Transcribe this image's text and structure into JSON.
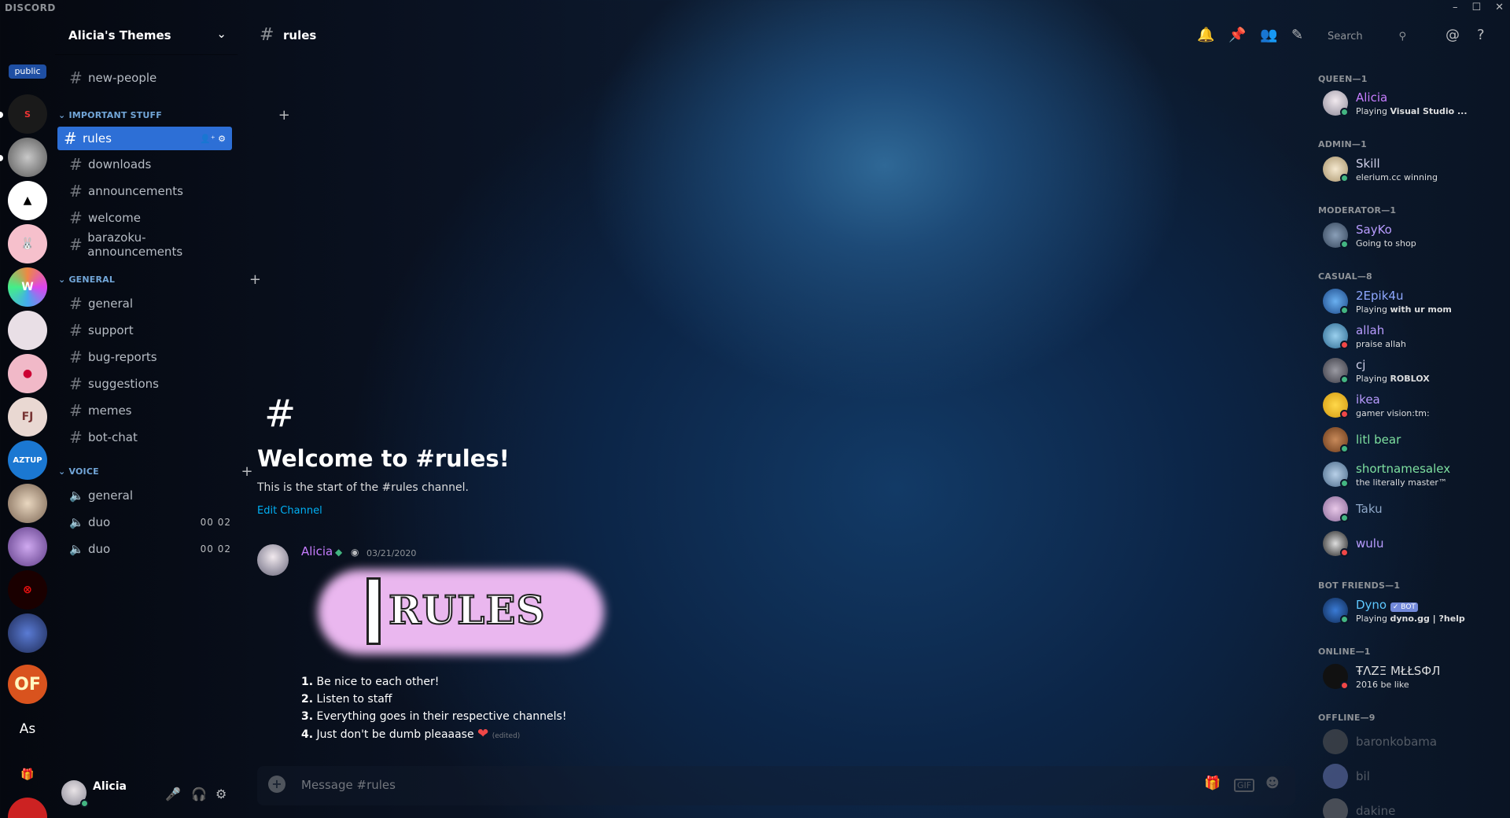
{
  "app": {
    "brand": "DISCORD"
  },
  "window": {
    "controls": [
      "–",
      "☐",
      "✕"
    ]
  },
  "server_list": {
    "public_badge": "public",
    "as_label": "As",
    "of_label": "OF"
  },
  "guild": {
    "name": "Alicia's Themes"
  },
  "channels": {
    "top": [
      {
        "name": "new-people"
      }
    ],
    "categories": [
      {
        "name": "IMPORTANT STUFF",
        "channels": [
          "rules",
          "downloads",
          "announcements",
          "welcome",
          "barazoku-announcements"
        ]
      },
      {
        "name": "GENERAL",
        "channels": [
          "general",
          "support",
          "bug-reports",
          "suggestions",
          "memes",
          "bot-chat"
        ]
      },
      {
        "name": "VOICE",
        "voice": [
          {
            "name": "general"
          },
          {
            "name": "duo",
            "count": "00 02"
          },
          {
            "name": "duo",
            "count": "00 02"
          }
        ]
      }
    ],
    "active": "rules"
  },
  "user": {
    "name": "Alicia",
    "status_color": "#43b581"
  },
  "header": {
    "channel": "rules",
    "search_placeholder": "Search"
  },
  "welcome": {
    "title": "Welcome to #rules!",
    "subtitle": "This is the start of the #rules channel.",
    "edit": "Edit Channel"
  },
  "message": {
    "author": "Alicia",
    "author_color": "#c77dff",
    "date": "03/21/2020",
    "image_text": "RULES",
    "rules": [
      {
        "n": "1.",
        "t": "Be nice to each other!"
      },
      {
        "n": "2.",
        "t": "Listen to staff"
      },
      {
        "n": "3.",
        "t": "Everything goes in their respective channels!"
      },
      {
        "n": "4.",
        "t": "Just don't be dumb pleaaase"
      }
    ],
    "edited": "(edited)"
  },
  "input": {
    "placeholder": "Message #rules"
  },
  "members": {
    "roles": [
      {
        "label": "QUEEN—1",
        "members": [
          {
            "name": "Alicia",
            "color": "#c77dff",
            "activity": "Playing ",
            "activity_bold": "Visual Studio ...",
            "status": "#43b581"
          }
        ]
      },
      {
        "label": "ADMIN—1",
        "members": [
          {
            "name": "Skill",
            "color": "#cfcfe8",
            "activity": "elerium.cc winning",
            "status": "#43b581"
          }
        ]
      },
      {
        "label": "MODERATOR—1",
        "members": [
          {
            "name": "SayKo",
            "color": "#b89cff",
            "activity": "Going to shop",
            "status": "#43b581"
          }
        ]
      },
      {
        "label": "CASUAL—8",
        "members": [
          {
            "name": "2Epik4u",
            "color": "#8fa8ff",
            "activity": "Playing ",
            "activity_bold": "with ur mom",
            "status": "#43b581"
          },
          {
            "name": "allah",
            "color": "#b89cff",
            "activity": "praise allah",
            "status": "#f04747"
          },
          {
            "name": "cj",
            "color": "#cfcfe8",
            "activity": "Playing ",
            "activity_bold": "ROBLOX",
            "status": "#43b581"
          },
          {
            "name": "ikea",
            "color": "#b89cff",
            "activity": "gamer vision:tm:",
            "status": "#f04747"
          },
          {
            "name": "litl bear",
            "color": "#7ee0a0",
            "activity": "",
            "status": "#43b581"
          },
          {
            "name": "shortnamesalex",
            "color": "#7ee0a0",
            "activity": "the literally master™",
            "status": "#43b581"
          },
          {
            "name": "Taku",
            "color": "#8fa8c8",
            "activity": "",
            "status": "#43b581"
          },
          {
            "name": "wulu",
            "color": "#b89cff",
            "activity": "",
            "status": "#f04747"
          }
        ]
      },
      {
        "label": "BOT FRIENDS—1",
        "members": [
          {
            "name": "Dyno",
            "color": "#5ec8ff",
            "activity": "Playing ",
            "activity_bold": "dyno.gg | ?help",
            "status": "#43b581",
            "bot": "✓ BOT"
          }
        ]
      },
      {
        "label": "ONLINE—1",
        "members": [
          {
            "name": "ŦΛZΞ MŁŁSФЛ",
            "color": "#dcddde",
            "activity": "2016 be like",
            "status": "#f04747"
          }
        ]
      },
      {
        "label": "OFFLINE—9",
        "members": [
          {
            "name": "baronkobama",
            "color": "#72767d"
          },
          {
            "name": "bil",
            "color": "#72767d"
          },
          {
            "name": "dakine",
            "color": "#72767d"
          }
        ]
      }
    ]
  }
}
